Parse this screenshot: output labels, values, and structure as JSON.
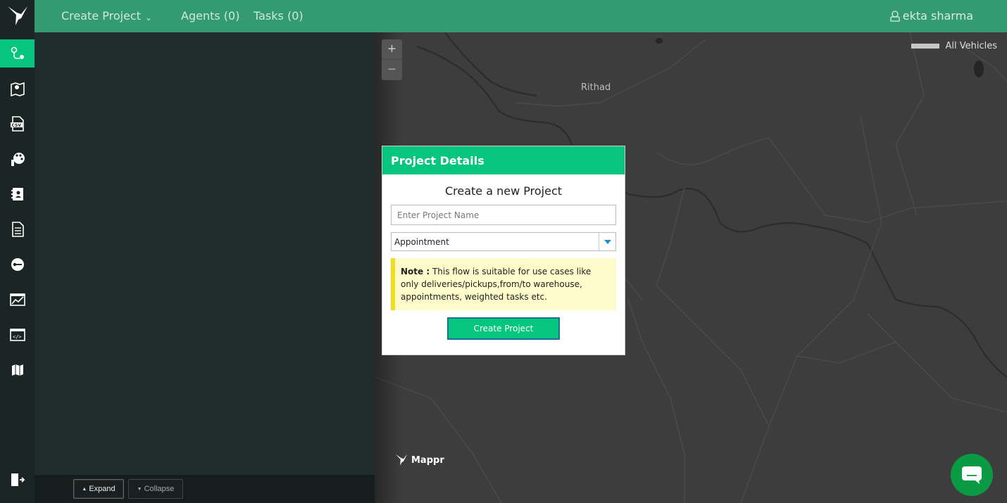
{
  "nav": {
    "create_project": "Create Project",
    "agents": "Agents (0)",
    "tasks": "Tasks (0)",
    "user": "ekta sharma"
  },
  "rail": {
    "items": [
      "route-planner-icon",
      "map-marker-icon",
      "csv-icon",
      "palette-icon",
      "contact-book-icon",
      "document-icon",
      "key-icon",
      "analytics-icon",
      "code-icon",
      "map-icon"
    ],
    "bottom": "logout-icon"
  },
  "panel_footer": {
    "expand": "Expand",
    "collapse": "Collapse"
  },
  "map": {
    "place_label": "Rithad",
    "legend": "All Vehicles",
    "brand": "Mappr",
    "zoom_in": "+",
    "zoom_out": "−"
  },
  "modal": {
    "title": "Project Details",
    "subtitle": "Create a new Project",
    "name_placeholder": "Enter Project Name",
    "type_selected": "Appointment",
    "note_label": "Note :",
    "note_text": "This flow is suitable for use cases like only deliveries/pickups,from/to warehouse, appointments, weighted tasks etc.",
    "submit": "Create Project"
  },
  "colors": {
    "topbar": "#349a72",
    "accent": "#06c57d",
    "rail": "#1b2523",
    "panel": "#1f2d2c",
    "map": "#3d3d3d",
    "note_bg": "#fdfbca",
    "note_border": "#f3dc1d",
    "chat": "#0a9a44"
  }
}
